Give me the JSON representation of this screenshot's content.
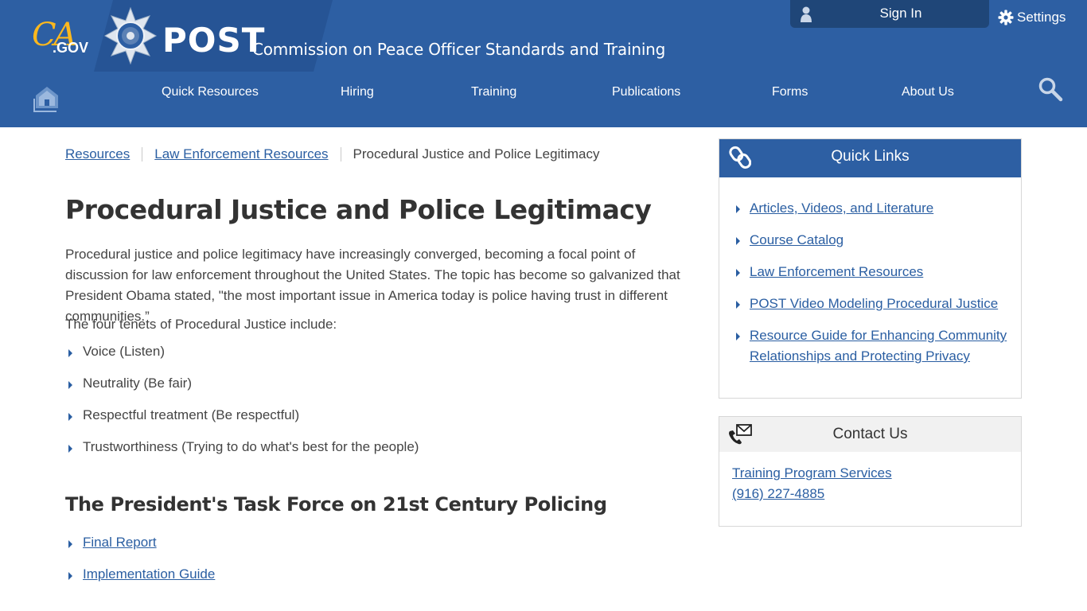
{
  "header": {
    "ca_logo_text": "CA",
    "gov_text": ".GOV",
    "post_title": "POST",
    "commission_title": "Commission on Peace Officer Standards and Training",
    "sign_in_label": "Sign In",
    "settings_label": "Settings"
  },
  "nav": {
    "items": [
      {
        "label": "Quick Resources"
      },
      {
        "label": "Hiring"
      },
      {
        "label": "Training"
      },
      {
        "label": "Publications"
      },
      {
        "label": "Forms"
      },
      {
        "label": "About Us"
      }
    ]
  },
  "breadcrumb": {
    "items": [
      "Resources",
      "Law Enforcement Resources"
    ],
    "current": "Procedural Justice and Police Legitimacy"
  },
  "main": {
    "title": "Procedural Justice and Police Legitimacy",
    "intro": "Procedural justice and police legitimacy have increasingly converged, becoming a focal point of discussion for law enforcement throughout the United States. The topic has become so galvanized that President Obama stated, \"the most important issue in America today is police having trust in different communities.”",
    "tenets_intro": "The four tenets of Procedural Justice include:",
    "tenets": [
      "Voice (Listen)",
      "Neutrality (Be fair)",
      "Respectful treatment (Be respectful)",
      "Trustworthiness (Trying to do what's best for the people)"
    ],
    "subtitle": "The President's Task Force on 21st Century Policing",
    "reports": [
      "Final Report",
      "Implementation Guide"
    ]
  },
  "quick_links": {
    "title": "Quick Links",
    "items": [
      "Articles, Videos, and Literature",
      "Course Catalog",
      "Law Enforcement Resources",
      "POST Video Modeling Procedural Justice",
      "Resource Guide for Enhancing Community Relationships and Protecting Privacy"
    ]
  },
  "contact": {
    "title": "Contact Us",
    "name": "Training Program Services",
    "phone": "(916) 227-4885"
  },
  "colors": {
    "header_blue": "#2d5fa3",
    "link_blue": "#2a5ea2",
    "ca_gold": "#fdb81e"
  }
}
